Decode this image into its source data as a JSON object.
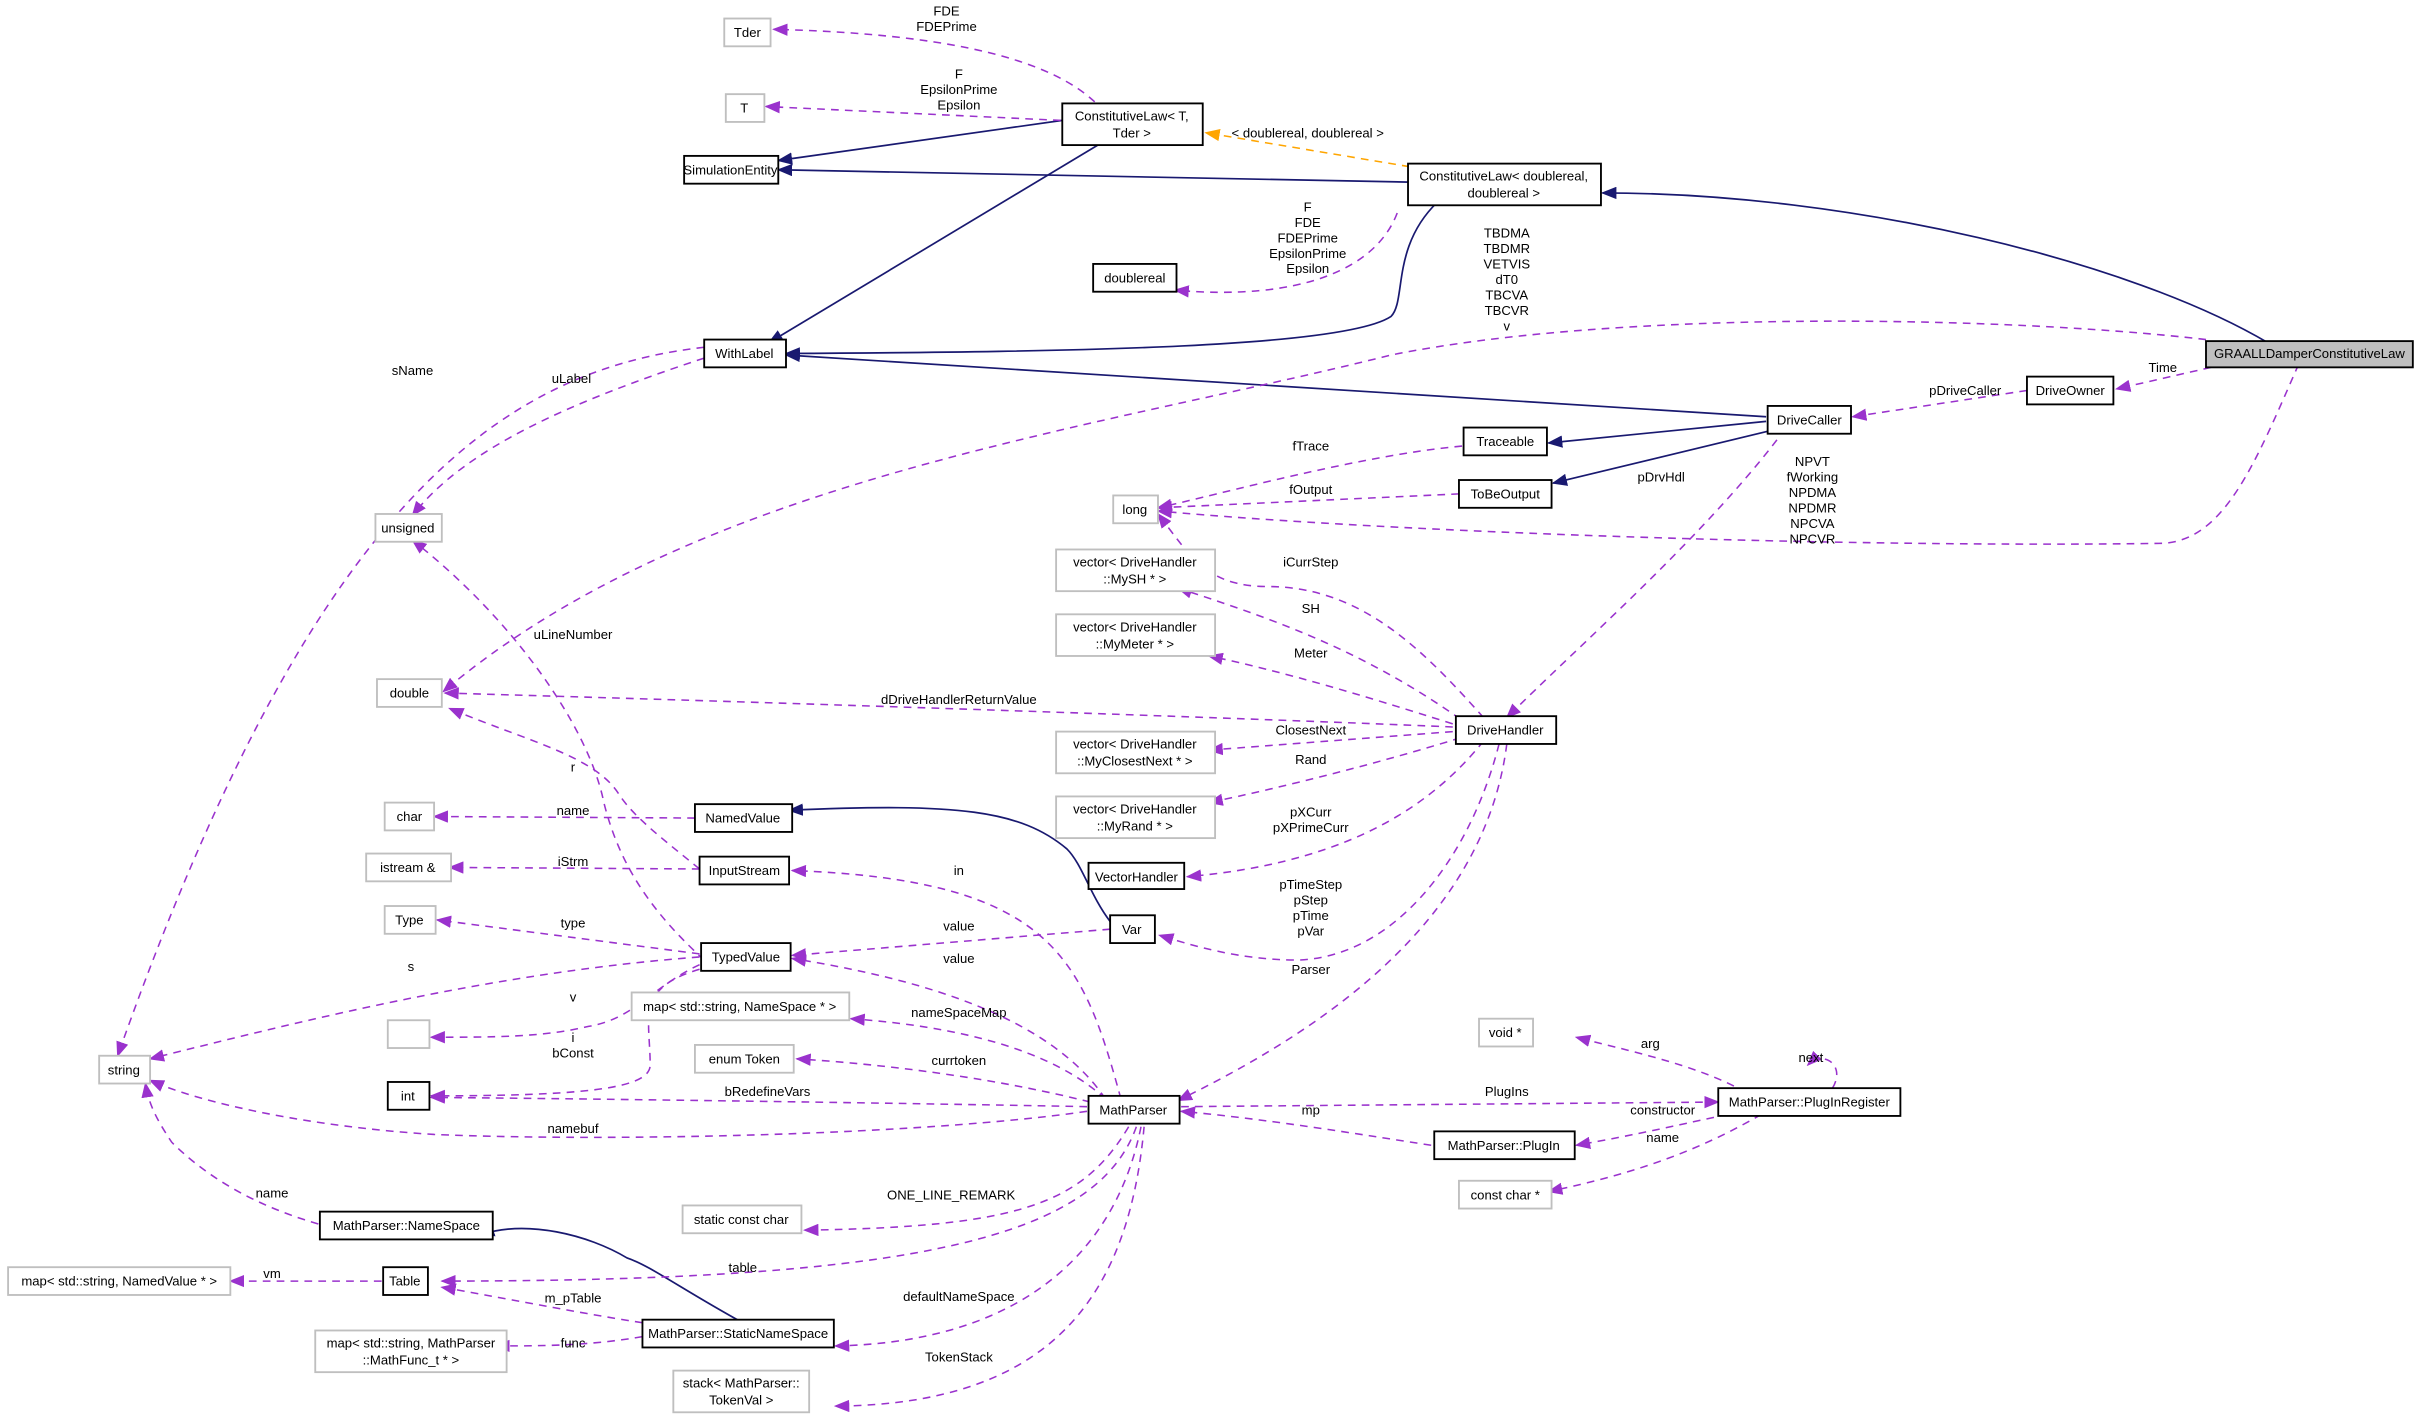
{
  "diagram": {
    "type": "collaboration-graph",
    "focus_node": "GRAALLDamperConstitutiveLaw",
    "colors": {
      "inheritance_edge": "#191970",
      "usage_edge": "#9a32cd",
      "template_edge": "#ffa500",
      "focus_fill": "#bfbfbf",
      "documented_border": "#000000",
      "undocumented_border": "#bfbfbf"
    },
    "nodes": {
      "tder": "Tder",
      "t": "T",
      "simulation_entity": "SimulationEntity",
      "constitutive_law_t": [
        "ConstitutiveLaw< T,",
        "Tder >"
      ],
      "constitutive_law_dd": [
        "ConstitutiveLaw< doublereal,",
        "doublereal >"
      ],
      "doublereal": "doublereal",
      "with_label": "WithLabel",
      "graall": "GRAALLDamperConstitutiveLaw",
      "drive_owner": "DriveOwner",
      "drive_caller": "DriveCaller",
      "traceable": "Traceable",
      "to_be_output": "ToBeOutput",
      "long": "long",
      "unsigned": "unsigned",
      "vec_mysh": [
        "vector< DriveHandler",
        "::MySH * >"
      ],
      "vec_mymeter": [
        "vector< DriveHandler",
        "::MyMeter * >"
      ],
      "double": "double",
      "drive_handler": "DriveHandler",
      "vec_closest": [
        "vector< DriveHandler",
        "::MyClosestNext * >"
      ],
      "vec_rand": [
        "vector< DriveHandler",
        "::MyRand * >"
      ],
      "char": "char",
      "named_value": "NamedValue",
      "istream": "istream &",
      "input_stream": "InputStream",
      "vector_handler": "VectorHandler",
      "type": "Type",
      "var": "Var",
      "typed_value": "TypedValue",
      "empty": "",
      "map_ns": "map< std::string, NameSpace * >",
      "string": "string",
      "enum_token": "enum Token",
      "int": "int",
      "math_parser": "MathParser",
      "void_ptr": "void *",
      "plugin_register": "MathParser::PlugInRegister",
      "plugin": "MathParser::PlugIn",
      "const_char_ptr": "const char *",
      "static_const_char": "static const char",
      "namespace": "MathParser::NameSpace",
      "map_nv": "map< std::string, NamedValue * >",
      "table": "Table",
      "static_namespace": "MathParser::StaticNameSpace",
      "map_func": [
        "map< std::string, MathParser",
        "::MathFunc_t * >"
      ],
      "stack_token": [
        "stack< MathParser::",
        "TokenVal >"
      ]
    },
    "edge_labels": {
      "tder": [
        "FDE",
        "FDEPrime"
      ],
      "t": [
        "F",
        "EpsilonPrime",
        "Epsilon"
      ],
      "template_args": "< doublereal, doublereal >",
      "doublereal": [
        "F",
        "FDE",
        "FDEPrime",
        "EpsilonPrime",
        "Epsilon"
      ],
      "graall_double": [
        "TBDMA",
        "TBDMR",
        "VETVIS",
        "dT0",
        "TBCVA",
        "TBCVR",
        "v"
      ],
      "s_name": "sName",
      "u_label": "uLabel",
      "time": "Time",
      "p_drive_caller": "pDriveCaller",
      "f_trace": "fTrace",
      "f_output": "fOutput",
      "p_drv_hdl": "pDrvHdl",
      "graall_long": [
        "NPVT",
        "fWorking",
        "NPDMA",
        "NPDMR",
        "NPCVA",
        "NPCVR"
      ],
      "i_curr_step": "iCurrStep",
      "sh": "SH",
      "u_line_number": "uLineNumber",
      "meter": "Meter",
      "d_drive_ret": "dDriveHandlerReturnValue",
      "closest_next": "ClosestNext",
      "rand": "Rand",
      "r": "r",
      "name_char": "name",
      "p_x_curr": [
        "pXCurr",
        "pXPrimeCurr"
      ],
      "i_strm": "iStrm",
      "in": "in",
      "type": "type",
      "value_var": "value",
      "p_time_step": [
        "pTimeStep",
        "pStep",
        "pTime",
        "pVar"
      ],
      "s": "s",
      "value_mp": "value",
      "parser": "Parser",
      "v": "v",
      "name_space_map": "nameSpaceMap",
      "i_bconst": [
        "i",
        "bConst"
      ],
      "curr_token": "currtoken",
      "arg": "arg",
      "next": "next",
      "b_redefine_vars": "bRedefineVars",
      "plugins": "PlugIns",
      "mp": "mp",
      "constructor": "constructor",
      "namebuf": "namebuf",
      "name_const_char": "name",
      "name_ns": "name",
      "one_line_remark": "ONE_LINE_REMARK",
      "table": "table",
      "vm": "vm",
      "m_p_table": "m_pTable",
      "default_ns": "defaultNameSpace",
      "func": "func",
      "token_stack": "TokenStack"
    }
  }
}
